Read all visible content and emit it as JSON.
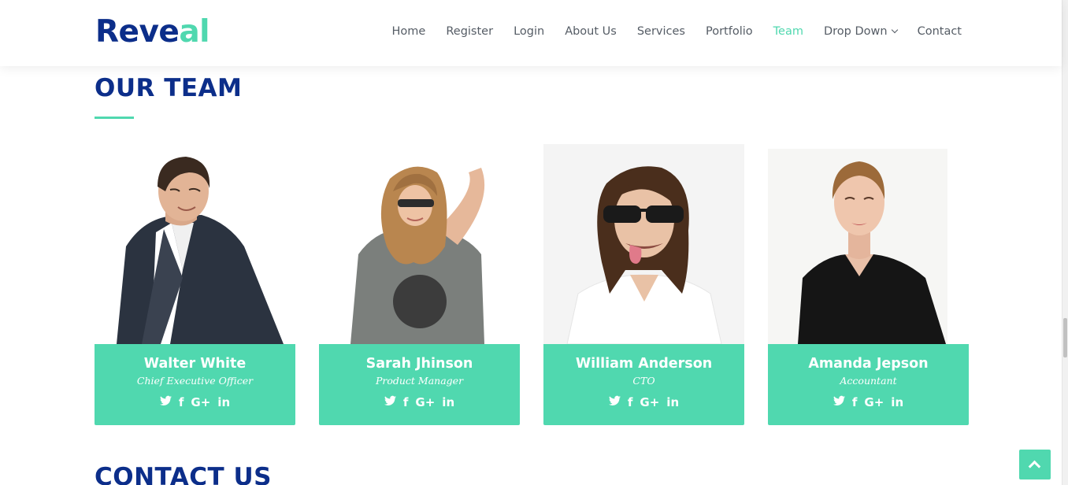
{
  "brand": {
    "logo_main": "Reve",
    "logo_accent": "al"
  },
  "nav": {
    "items": [
      {
        "label": "Home",
        "active": false
      },
      {
        "label": "Register",
        "active": false
      },
      {
        "label": "Login",
        "active": false
      },
      {
        "label": "About Us",
        "active": false
      },
      {
        "label": "Services",
        "active": false
      },
      {
        "label": "Portfolio",
        "active": false
      },
      {
        "label": "Team",
        "active": true
      },
      {
        "label": "Drop Down",
        "active": false,
        "dropdown": true
      },
      {
        "label": "Contact",
        "active": false
      }
    ]
  },
  "team_section": {
    "title": "OUR TEAM",
    "members": [
      {
        "name": "Walter White",
        "role": "Chief Executive Officer",
        "social": [
          "twitter-icon",
          "facebook-icon",
          "google-plus-icon",
          "linkedin-icon"
        ]
      },
      {
        "name": "Sarah Jhinson",
        "role": "Product Manager",
        "social": [
          "twitter-icon",
          "facebook-icon",
          "google-plus-icon",
          "linkedin-icon"
        ]
      },
      {
        "name": "William Anderson",
        "role": "CTO",
        "social": [
          "twitter-icon",
          "facebook-icon",
          "google-plus-icon",
          "linkedin-icon"
        ]
      },
      {
        "name": "Amanda Jepson",
        "role": "Accountant",
        "social": [
          "twitter-icon",
          "facebook-icon",
          "google-plus-icon",
          "linkedin-icon"
        ]
      }
    ]
  },
  "social_glyphs": {
    "twitter": "🐦",
    "facebook": "f",
    "google_plus": "G+",
    "linkedin": "in"
  },
  "contact_section": {
    "title": "CONTACT US"
  },
  "colors": {
    "primary": "#0c2e8a",
    "accent": "#50d8af",
    "nav_text": "#555c65"
  }
}
